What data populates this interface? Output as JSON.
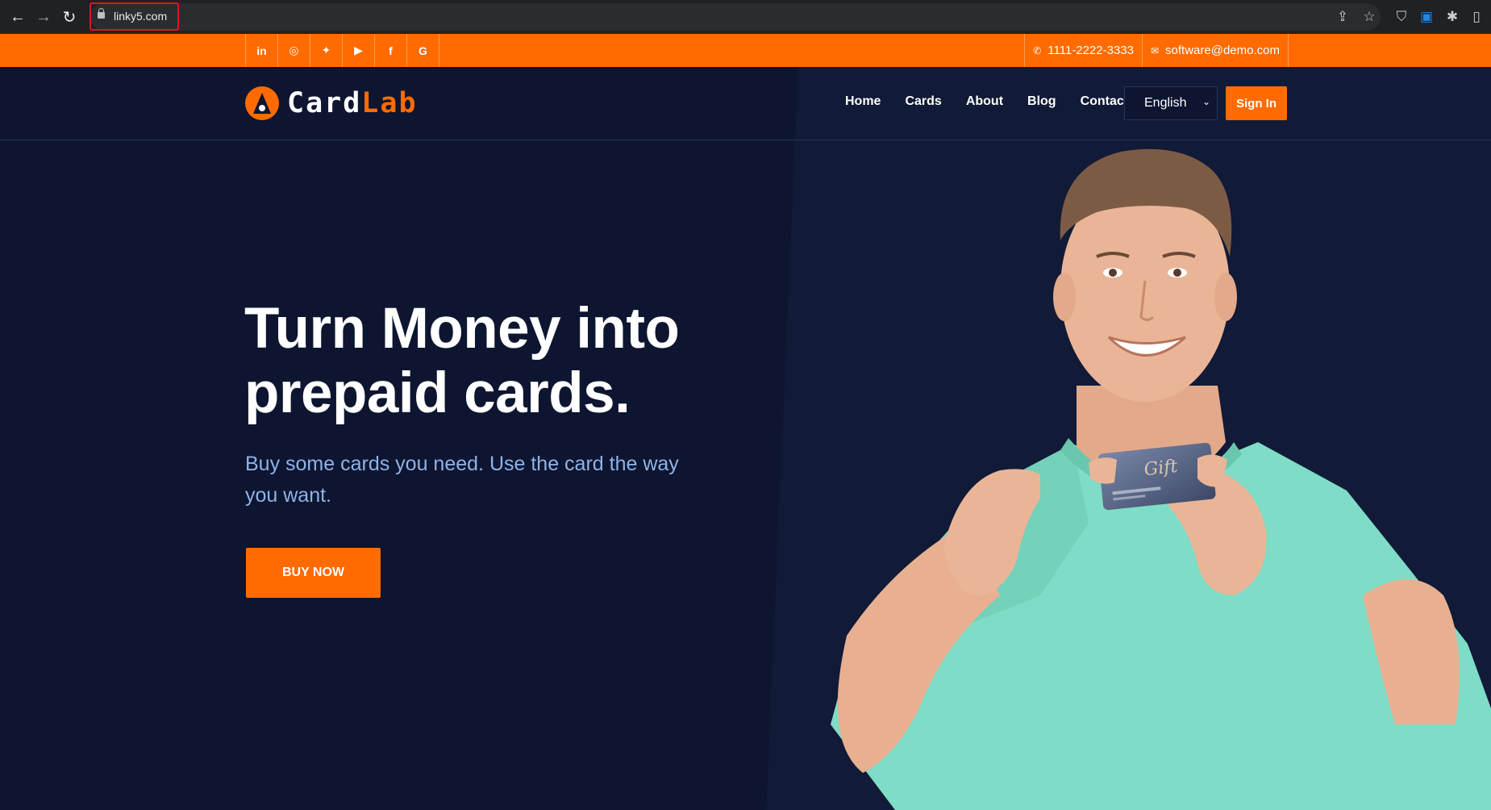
{
  "browser": {
    "url": "linky5.com"
  },
  "topbar": {
    "social": [
      "linkedin-icon",
      "instagram-icon",
      "twitter-icon",
      "youtube-icon",
      "facebook-icon",
      "google-icon"
    ],
    "phone": "1111-2222-3333",
    "email": "software@demo.com"
  },
  "header": {
    "logo_card": "Card",
    "logo_lab": "Lab",
    "nav": [
      "Home",
      "Cards",
      "About",
      "Blog",
      "Contact"
    ],
    "language": "English",
    "signin_label": "Sign In"
  },
  "hero": {
    "headline_line1": "Turn Money into",
    "headline_line2": "prepaid cards.",
    "subtext": "Buy some cards you need. Use the card the way you want.",
    "cta_label": "BUY NOW",
    "gift_card_text": "Gift"
  },
  "colors": {
    "accent": "#ff6b00",
    "background": "#0d1530",
    "subtext": "#8fb3e6",
    "shirt": "#7fdcc6"
  }
}
